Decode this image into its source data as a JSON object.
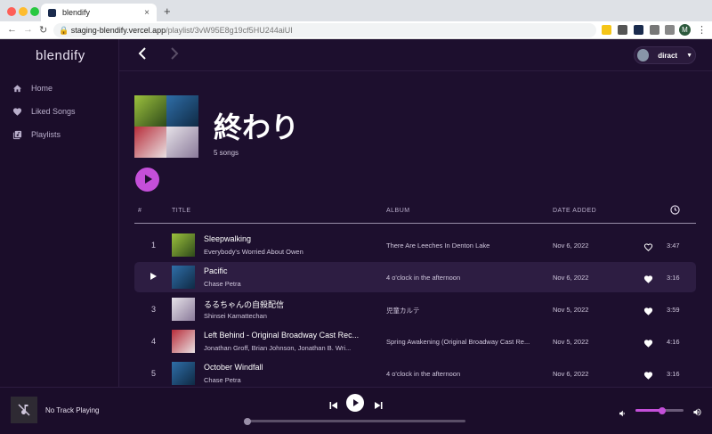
{
  "browser": {
    "tab_title": "blendify",
    "url_host": "staging-blendify.vercel.app",
    "url_path": "/playlist/3vW95E8g19cf5HU244aiUI",
    "profile_initial": "M"
  },
  "sidebar": {
    "logo": "blendify",
    "items": [
      {
        "label": "Home",
        "icon": "home-icon"
      },
      {
        "label": "Liked Songs",
        "icon": "heart-icon"
      },
      {
        "label": "Playlists",
        "icon": "library-icon"
      }
    ]
  },
  "header": {
    "user": "diract"
  },
  "playlist": {
    "title": "終わり",
    "count": "5 songs"
  },
  "table": {
    "col_num": "#",
    "col_title": "TITLE",
    "col_album": "ALBUM",
    "col_date": "DATE ADDED",
    "rows": [
      {
        "num": "1",
        "title": "Sleepwalking",
        "artist": "Everybody's Worried About Owen",
        "album": "There Are Leeches In Denton Lake",
        "date": "Nov 6, 2022",
        "liked": false,
        "duration": "3:47"
      },
      {
        "num": "2",
        "title": "Pacific",
        "artist": "Chase Petra",
        "album": "4 o'clock in the afternoon",
        "date": "Nov 6, 2022",
        "liked": true,
        "duration": "3:16"
      },
      {
        "num": "3",
        "title": "るるちゃんの自殺配信",
        "artist": "Shinsei Kamattechan",
        "album": "児童カルテ",
        "date": "Nov 5, 2022",
        "liked": true,
        "duration": "3:59"
      },
      {
        "num": "4",
        "title": "Left Behind - Original Broadway Cast Rec...",
        "artist": "Jonathan Groff, Brian Johnson, Jonathan B. Wri...",
        "album": "Spring Awakening (Original Broadway Cast Re...",
        "date": "Nov 5, 2022",
        "liked": true,
        "duration": "4:16"
      },
      {
        "num": "5",
        "title": "October Windfall",
        "artist": "Chase Petra",
        "album": "4 o'clock in the afternoon",
        "date": "Nov 6, 2022",
        "liked": true,
        "duration": "3:16"
      }
    ]
  },
  "player": {
    "now_playing": "No Track Playing",
    "progress": 0,
    "volume": 0.55
  },
  "colors": {
    "accent": "#c44fd9",
    "background": "#1d0f2e"
  }
}
